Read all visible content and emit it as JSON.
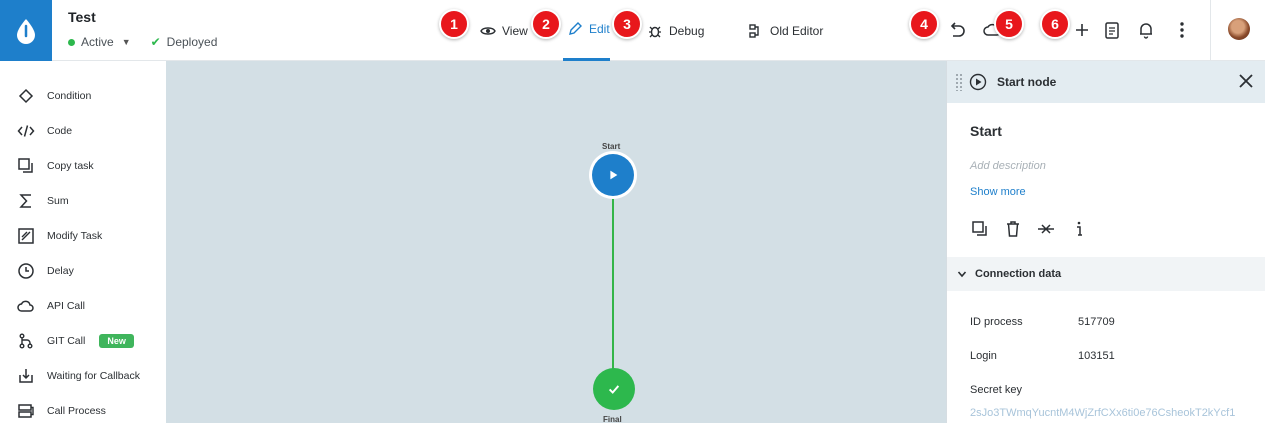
{
  "header": {
    "process_name": "Test",
    "status": "Active",
    "deploy_status": "Deployed",
    "tabs": [
      {
        "label": "View",
        "badge": "1"
      },
      {
        "label": "Edit",
        "badge": "2"
      },
      {
        "label": "Debug",
        "badge": "3"
      },
      {
        "label": "Old Editor"
      }
    ],
    "toolbar_badges": [
      "4",
      "5",
      "6"
    ]
  },
  "sidebar": {
    "items": [
      {
        "label": "Condition",
        "icon": "diamond-icon"
      },
      {
        "label": "Code",
        "icon": "code-icon"
      },
      {
        "label": "Copy task",
        "icon": "copy-icon"
      },
      {
        "label": "Sum",
        "icon": "sigma-icon"
      },
      {
        "label": "Modify Task",
        "icon": "edit-square-icon"
      },
      {
        "label": "Delay",
        "icon": "clock-icon"
      },
      {
        "label": "API Call",
        "icon": "cloud-icon"
      },
      {
        "label": "GIT Call",
        "icon": "git-icon",
        "tag": "New"
      },
      {
        "label": "Waiting for Callback",
        "icon": "download-icon"
      },
      {
        "label": "Call Process",
        "icon": "call-process-icon"
      }
    ]
  },
  "canvas": {
    "start_label": "Start",
    "final_label": "Final"
  },
  "panel": {
    "title": "Start node",
    "node_name": "Start",
    "description_placeholder": "Add description",
    "show_more": "Show more",
    "section_title": "Connection data",
    "fields": [
      {
        "label": "ID process",
        "value": "517709"
      },
      {
        "label": "Login",
        "value": "103151"
      }
    ],
    "secret_label": "Secret key",
    "secret_value": "2sJo3TWmqYucntM4WjZrfCXx6ti0e76CsheokT2kYcf1"
  },
  "colors": {
    "accent": "#1e7fcb",
    "success": "#2db84d",
    "badge": "#e8171c",
    "canvas_bg": "#d3dfe5"
  }
}
